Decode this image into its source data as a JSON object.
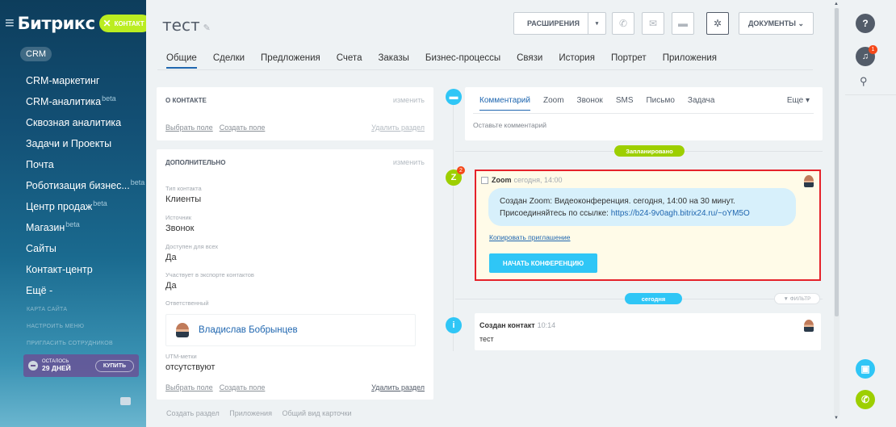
{
  "sidebar": {
    "logo": "Битрикс",
    "contact_badge": "КОНТАКТ",
    "section": "CRM",
    "items": [
      {
        "label": "CRM-маркетинг",
        "sup": ""
      },
      {
        "label": "CRM-аналитика",
        "sup": "beta"
      },
      {
        "label": "Сквозная аналитика",
        "sup": ""
      },
      {
        "label": "Задачи и Проекты",
        "sup": ""
      },
      {
        "label": "Почта",
        "sup": ""
      },
      {
        "label": "Роботизация бизнес...",
        "sup": "beta"
      },
      {
        "label": "Центр продаж",
        "sup": "beta"
      },
      {
        "label": "Магазин",
        "sup": "beta"
      },
      {
        "label": "Сайты",
        "sup": ""
      },
      {
        "label": "Контакт-центр",
        "sup": ""
      },
      {
        "label": "Ещё -",
        "sup": ""
      }
    ],
    "small_links": [
      "КАРТА САЙТА",
      "НАСТРОИТЬ МЕНЮ",
      "ПРИГЛАСИТЬ СОТРУДНИКОВ"
    ],
    "trial": {
      "label_top": "ОСТАЛОСЬ",
      "label_days": "29 ДНЕЙ",
      "buy": "КУПИТЬ"
    }
  },
  "header": {
    "title": "тест",
    "extensions": "РАСШИРЕНИЯ",
    "documents": "ДОКУМЕНТЫ"
  },
  "tabs": [
    "Общие",
    "Сделки",
    "Предложения",
    "Счета",
    "Заказы",
    "Бизнес-процессы",
    "Связи",
    "История",
    "Портрет",
    "Приложения"
  ],
  "card_contact": {
    "heading": "О КОНТАКТЕ",
    "edit": "изменить",
    "link_select": "Выбрать поле",
    "link_create": "Создать поле",
    "delete": "Удалить раздел"
  },
  "card_extra": {
    "heading": "ДОПОЛНИТЕЛЬНО",
    "edit": "изменить",
    "fields": [
      {
        "label": "Тип контакта",
        "value": "Клиенты"
      },
      {
        "label": "Источник",
        "value": "Звонок"
      },
      {
        "label": "Доступен для всех",
        "value": "Да"
      },
      {
        "label": "Участвует в экспорте контактов",
        "value": "Да"
      }
    ],
    "responsible_label": "Ответственный",
    "responsible_name": "Владислав Бобрынцев",
    "utm_label": "UTM-метки",
    "utm_value": "отсутствуют",
    "link_select": "Выбрать поле",
    "link_create": "Создать поле",
    "delete": "Удалить раздел"
  },
  "bottom_links": [
    "Создать раздел",
    "Приложения",
    "Общий вид карточки"
  ],
  "timeline": {
    "comment_tabs": [
      "Комментарий",
      "Zoom",
      "Звонок",
      "SMS",
      "Письмо",
      "Задача"
    ],
    "more": "Еще",
    "placeholder": "Оставьте комментарий",
    "planned": "Запланировано",
    "zoom_badge": "2",
    "zoom": {
      "title": "Zoom",
      "time": "сегодня, 14:00",
      "message_line1": "Создан Zoom: Видеоконференция. сегодня, 14:00 на 30 минут.",
      "message_line2": "Присоединяйтесь по ссылке: ",
      "link": "https://b24-9v0agh.bitrix24.ru/~oYM5O",
      "copy": "Копировать приглашение",
      "start": "НАЧАТЬ КОНФЕРЕНЦИЮ"
    },
    "today": "сегодня",
    "filter": "ФИЛЬТР",
    "created": {
      "title": "Создан контакт",
      "time": "10:14",
      "text": "тест"
    }
  },
  "right_panel": {
    "bell_badge": "1"
  }
}
